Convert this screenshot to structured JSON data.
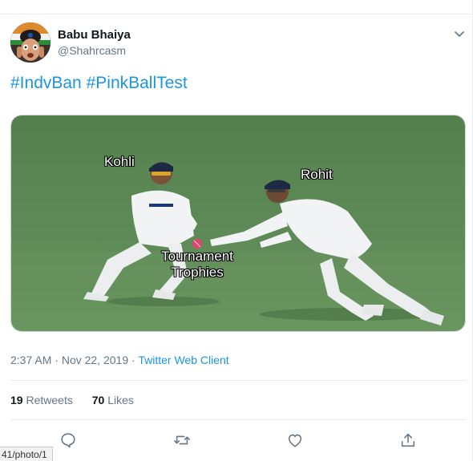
{
  "author": {
    "name": "Babu Bhaiya",
    "handle": "@Shahrcasm"
  },
  "hashtags": [
    "#IndvBan",
    "#PinkBallTest"
  ],
  "media": {
    "labels": {
      "left_player": "Kohli",
      "right_player": "Rohit",
      "ball": "Tournament\nTrophies"
    }
  },
  "meta": {
    "time": "2:37 AM",
    "sep1": " · ",
    "date": "Nov 22, 2019",
    "sep2": " · ",
    "client": "Twitter Web Client"
  },
  "stats": {
    "retweets_count": "19",
    "retweets_label": "Retweets",
    "likes_count": "70",
    "likes_label": "Likes"
  },
  "actions": [
    "reply-icon",
    "retweet-icon",
    "like-icon",
    "share-icon"
  ],
  "status_url": "41/photo/1",
  "colors": {
    "link": "#1b95e0",
    "muted": "#657786",
    "text": "#14171a",
    "field": "#5e8a57"
  }
}
